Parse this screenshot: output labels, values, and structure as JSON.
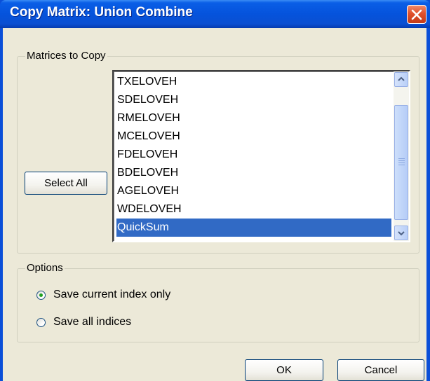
{
  "window": {
    "title": "Copy Matrix: Union Combine"
  },
  "matrices_group": {
    "legend": "Matrices to Copy",
    "select_all_label": "Select All",
    "items": [
      {
        "label": "TXELOVEH",
        "selected": false
      },
      {
        "label": "SDELOVEH",
        "selected": false
      },
      {
        "label": "RMELOVEH",
        "selected": false
      },
      {
        "label": "MCELOVEH",
        "selected": false
      },
      {
        "label": "FDELOVEH",
        "selected": false
      },
      {
        "label": "BDELOVEH",
        "selected": false
      },
      {
        "label": "AGELOVEH",
        "selected": false
      },
      {
        "label": "WDELOVEH",
        "selected": false
      },
      {
        "label": "QuickSum",
        "selected": true
      }
    ]
  },
  "options_group": {
    "legend": "Options",
    "radios": [
      {
        "label": "Save current index only",
        "checked": true
      },
      {
        "label": "Save all indices",
        "checked": false
      }
    ]
  },
  "footer": {
    "ok_label": "OK",
    "cancel_label": "Cancel"
  },
  "colors": {
    "title_bar": "#0553dc",
    "selection": "#316ac5",
    "dialog_bg": "#ece9d8",
    "close_button": "#e0512c"
  },
  "icons": {
    "close": "close-icon",
    "scroll_up": "chevron-up-icon",
    "scroll_down": "chevron-down-icon"
  }
}
